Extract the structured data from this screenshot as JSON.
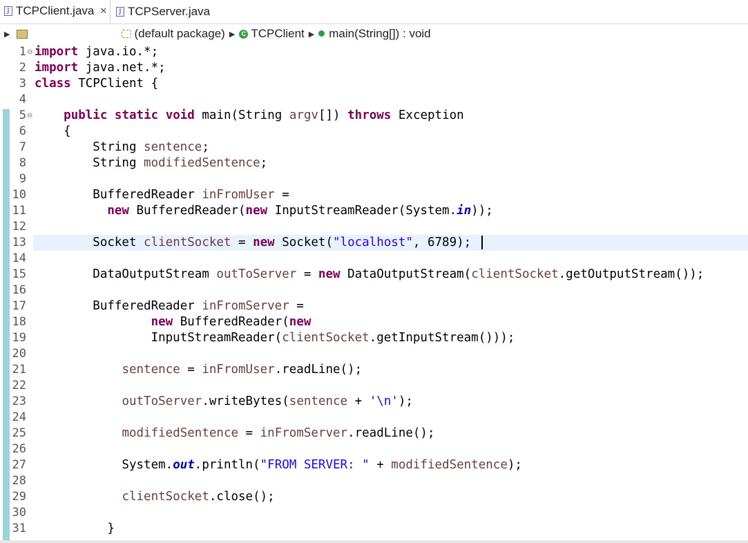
{
  "tabs": [
    {
      "label": "TCPClient.java",
      "close": "✕",
      "active": true
    },
    {
      "label": "TCPServer.java",
      "active": false
    }
  ],
  "breadcrumb": {
    "package": "(default package)",
    "class": "TCPClient",
    "method": "main(String[]) : void"
  },
  "colors": {
    "keyword": "#7f0055",
    "local_variable": "#6a3e3e",
    "string": "#2a00ff",
    "static_field": "#0000c0",
    "current_line": "#e8f2fe",
    "change_marker": "#9ed3d8"
  },
  "line_numbers": [
    "1",
    "2",
    "3",
    "4",
    "5",
    "6",
    "7",
    "8",
    "9",
    "10",
    "11",
    "12",
    "13",
    "14",
    "15",
    "16",
    "17",
    "18",
    "19",
    "20",
    "21",
    "22",
    "23",
    "24",
    "25",
    "26",
    "27",
    "28",
    "29",
    "30",
    "31"
  ],
  "code": {
    "l1": [
      "import",
      " java.io.*;"
    ],
    "l2": [
      "import",
      " java.net.*;"
    ],
    "l3": [
      "class",
      " TCPClient {"
    ],
    "l5": [
      "    ",
      "public",
      " ",
      "static",
      " ",
      "void",
      " main(String ",
      "argv",
      "[]) ",
      "throws",
      " Exception"
    ],
    "l6": "    {",
    "l7": [
      "        String ",
      "sentence",
      ";"
    ],
    "l8": [
      "        String ",
      "modifiedSentence",
      ";"
    ],
    "l10": [
      "        BufferedReader ",
      "inFromUser",
      " ="
    ],
    "l11": [
      "          ",
      "new",
      " BufferedReader(",
      "new",
      " InputStreamReader(System.",
      "in",
      "));"
    ],
    "l13": [
      "        Socket ",
      "clientSocket",
      " = ",
      "new",
      " Socket(",
      "\"localhost\"",
      ", 6789); "
    ],
    "l15": [
      "        DataOutputStream ",
      "outToServer",
      " = ",
      "new",
      " DataOutputStream(",
      "clientSocket",
      ".getOutputStream());"
    ],
    "l17": [
      "        BufferedReader ",
      "inFromServer",
      " ="
    ],
    "l18": [
      "                ",
      "new",
      " BufferedReader(",
      "new"
    ],
    "l19": [
      "                InputStreamReader(",
      "clientSocket",
      ".getInputStream()));"
    ],
    "l21": [
      "            ",
      "sentence",
      " = ",
      "inFromUser",
      ".readLine();"
    ],
    "l23": [
      "            ",
      "outToServer",
      ".writeBytes(",
      "sentence",
      " + ",
      "'\\n'",
      ");"
    ],
    "l25": [
      "            ",
      "modifiedSentence",
      " = ",
      "inFromServer",
      ".readLine();"
    ],
    "l27": [
      "            System.",
      "out",
      ".println(",
      "\"FROM SERVER: \"",
      " + ",
      "modifiedSentence",
      ");"
    ],
    "l29": [
      "            ",
      "clientSocket",
      ".close();"
    ],
    "l31": "          }"
  }
}
